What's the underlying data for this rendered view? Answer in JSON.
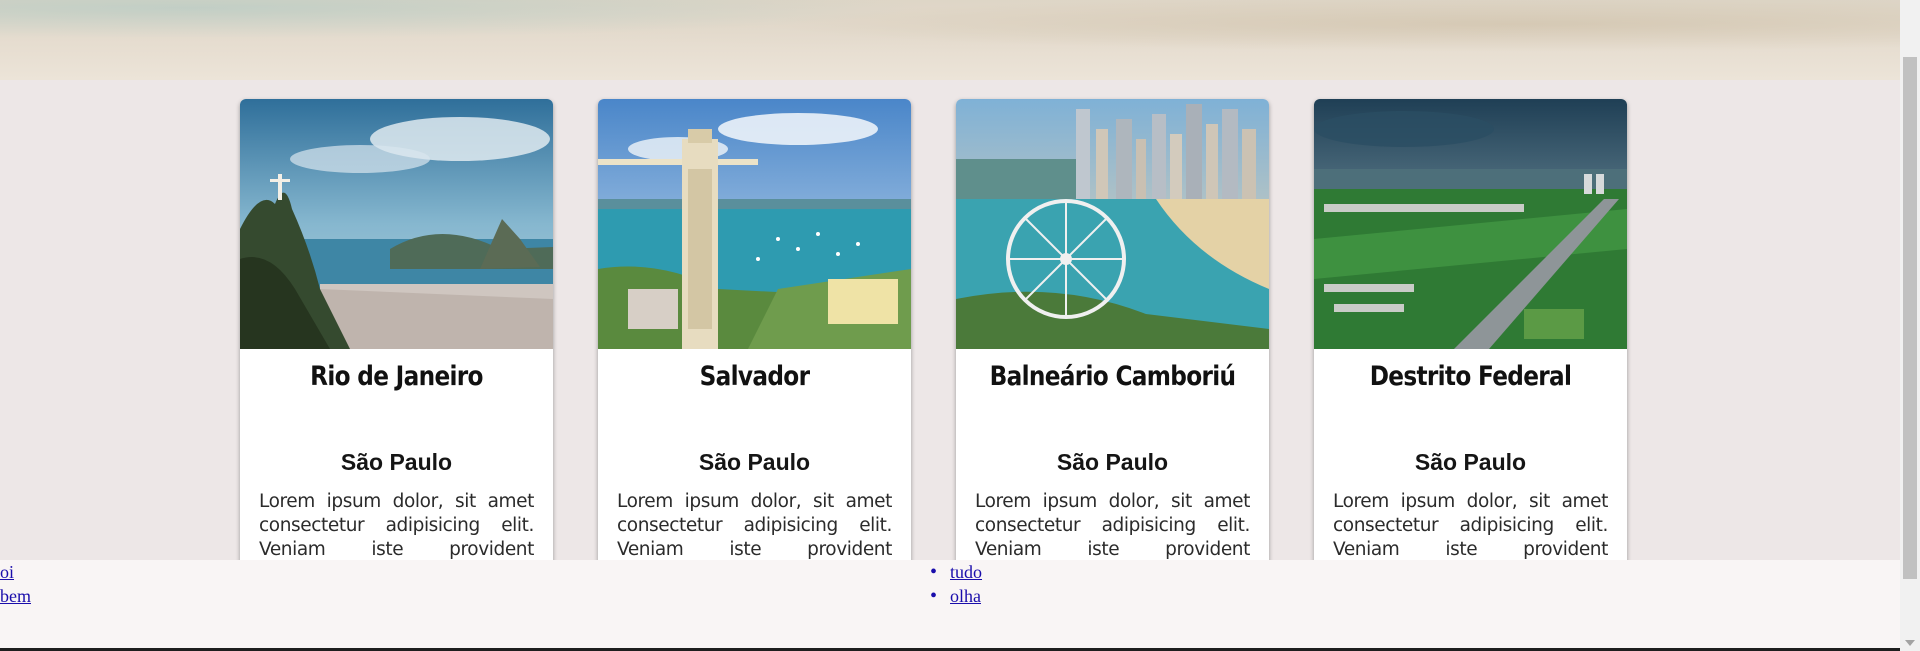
{
  "cards": [
    {
      "title": "Rio de Janeiro",
      "subtitle": "São Paulo",
      "text": "Lorem ipsum dolor, sit amet consectetur adipisicing elit. Veniam iste provident voluptatibus vero tempore nisi"
    },
    {
      "title": "Salvador",
      "subtitle": "São Paulo",
      "text": "Lorem ipsum dolor, sit amet consectetur adipisicing elit. Veniam iste provident voluptatibus vero tempore nisi"
    },
    {
      "title": "Balneário Camboriú",
      "subtitle": "São Paulo",
      "text": "Lorem ipsum dolor, sit amet consectetur adipisicing elit. Veniam iste provident voluptatibus vero tempore nisi"
    },
    {
      "title": "Destrito Federal",
      "subtitle": "São Paulo",
      "text": "Lorem ipsum dolor, sit amet consectetur adipisicing elit. Veniam iste provident voluptatibus vero tempore nisi"
    }
  ],
  "footer": {
    "left_links": [
      "oi",
      "bem"
    ],
    "right_links": [
      "tudo",
      "olha"
    ]
  },
  "colors": {
    "page_background": "#ede7e7",
    "card_background": "#ffffff",
    "footer_background": "#f9f5f5",
    "link": "#1a0dab"
  }
}
